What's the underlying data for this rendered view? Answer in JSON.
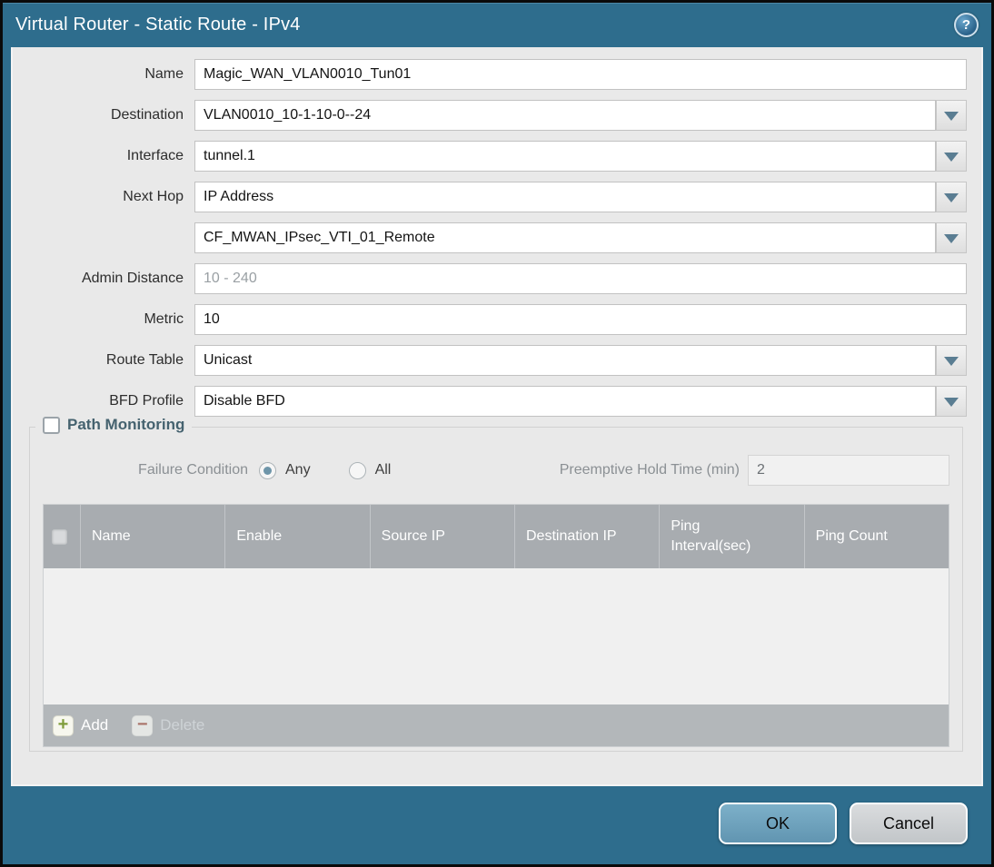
{
  "dialog": {
    "title": "Virtual Router - Static Route - IPv4"
  },
  "icons": {
    "help_glyph": "?",
    "add_glyph": "+",
    "delete_glyph": "−"
  },
  "form": {
    "name": {
      "label": "Name",
      "value": "Magic_WAN_VLAN0010_Tun01"
    },
    "destination": {
      "label": "Destination",
      "value": "VLAN0010_10-1-10-0--24"
    },
    "interface": {
      "label": "Interface",
      "value": "tunnel.1"
    },
    "next_hop": {
      "label": "Next Hop",
      "value": "IP Address"
    },
    "next_hop_address": {
      "value": "CF_MWAN_IPsec_VTI_01_Remote"
    },
    "admin_distance": {
      "label": "Admin Distance",
      "placeholder": "10 - 240",
      "value": ""
    },
    "metric": {
      "label": "Metric",
      "value": "10"
    },
    "route_table": {
      "label": "Route Table",
      "value": "Unicast"
    },
    "bfd_profile": {
      "label": "BFD Profile",
      "value": "Disable BFD"
    }
  },
  "path_monitoring": {
    "title": "Path Monitoring",
    "enabled": false,
    "failure_condition": {
      "label": "Failure Condition",
      "options": [
        {
          "label": "Any",
          "selected": true
        },
        {
          "label": "All",
          "selected": false
        }
      ]
    },
    "preemptive_hold_time": {
      "label": "Preemptive Hold Time (min)",
      "value": "2"
    },
    "table": {
      "columns": [
        "Name",
        "Enable",
        "Source IP",
        "Destination IP",
        "Ping Interval(sec)",
        "Ping Count"
      ],
      "rows": []
    },
    "add_label": "Add",
    "delete_label": "Delete"
  },
  "footer": {
    "ok_label": "OK",
    "cancel_label": "Cancel"
  },
  "colors": {
    "frame_teal": "#2e6d8d",
    "table_header_gray": "#a8acb0",
    "ok_button": "#6fa5bf"
  }
}
